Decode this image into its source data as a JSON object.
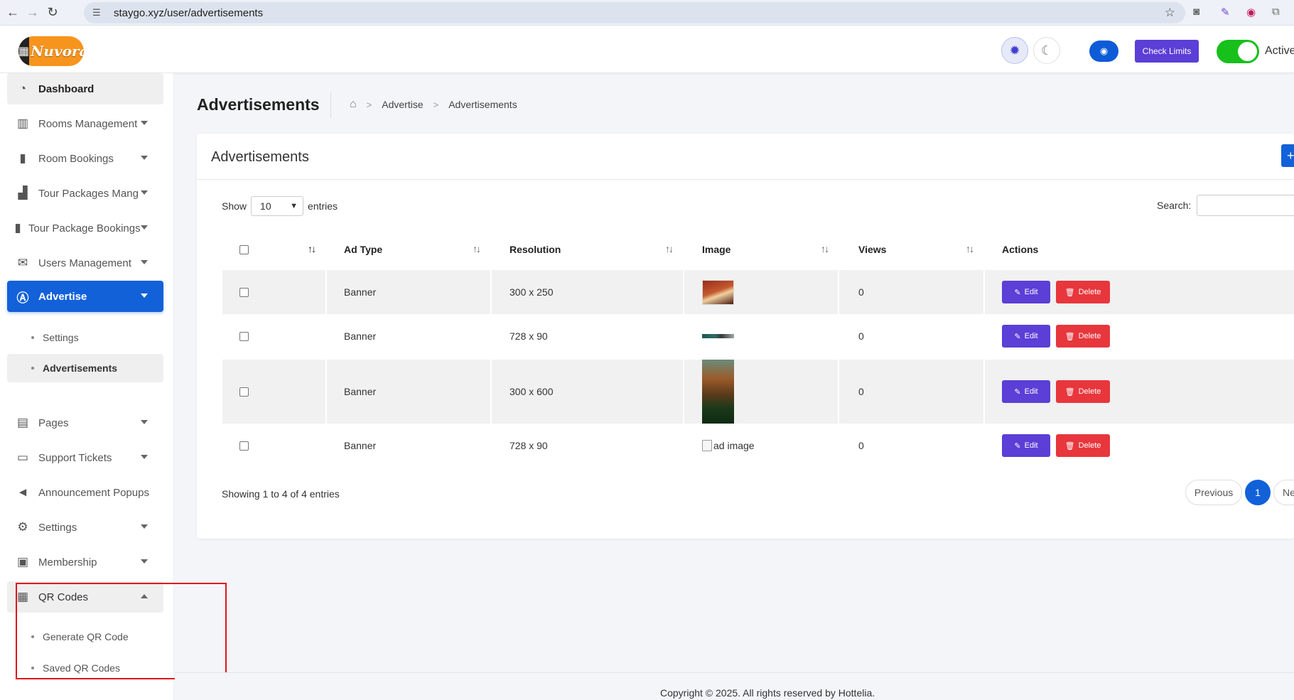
{
  "browser": {
    "url": "staygo.xyz/user/advertisements"
  },
  "header": {
    "logo_text": "Nuvora",
    "check_limits_label": "Check Limits",
    "status_label": "Active"
  },
  "sidebar": {
    "dashboard": "Dashboard",
    "rooms_management": "Rooms Management",
    "room_bookings": "Room Bookings",
    "tour_packages": "Tour Packages Mang",
    "tour_package_bookings": "Tour Package Bookings",
    "users_management": "Users Management",
    "advertise": "Advertise",
    "advertise_sub": [
      "Settings",
      "Advertisements"
    ],
    "pages": "Pages",
    "support_tickets": "Support Tickets",
    "announcement_popups": "Announcement Popups",
    "settings": "Settings",
    "membership": "Membership",
    "qr_codes": "QR Codes",
    "qr_sub": [
      "Generate QR Code",
      "Saved QR Codes"
    ]
  },
  "page": {
    "title": "Advertisements",
    "breadcrumb": [
      "Advertise",
      "Advertisements"
    ],
    "card_title": "Advertisements",
    "add_label": "+"
  },
  "table": {
    "show_label": "Show",
    "entries_value": "10",
    "entries_label": "entries",
    "search_label": "Search:",
    "columns": [
      "Ad Type",
      "Resolution",
      "Image",
      "Views",
      "Actions"
    ],
    "rows": [
      {
        "ad_type": "Banner",
        "resolution": "300 x 250",
        "views": "0"
      },
      {
        "ad_type": "Banner",
        "resolution": "728 x 90",
        "views": "0"
      },
      {
        "ad_type": "Banner",
        "resolution": "300 x 600",
        "views": "0"
      },
      {
        "ad_type": "Banner",
        "resolution": "728 x 90",
        "views": "0",
        "image_alt": "ad image"
      }
    ],
    "edit_label": "Edit",
    "delete_label": "Delete",
    "info": "Showing 1 to 4 of 4 entries",
    "previous_label": "Previous",
    "current_page": "1",
    "next_label": "Ne"
  },
  "footer": {
    "copyright": "Copyright © 2025. All rights reserved by Hottelia."
  },
  "colors": {
    "primary_blue": "#1261d9",
    "purple": "#5b3fd6",
    "delete_red": "#e8363d",
    "toggle_green": "#17c01b",
    "highlight_red": "#e0141c"
  }
}
